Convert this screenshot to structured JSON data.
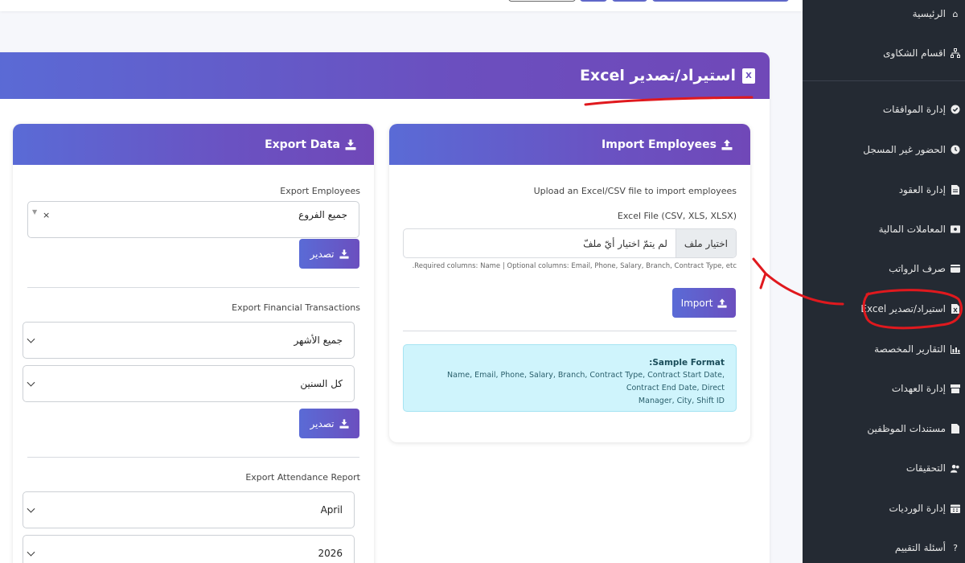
{
  "page": {
    "title": "استيراد/تصدير Excel"
  },
  "sidebar": {
    "items": [
      {
        "label": "الرئيسية",
        "icon": "home-icon"
      },
      {
        "label": "اقسام الشكاوى",
        "icon": "sitemap-icon"
      },
      {
        "label": "إدارة الموافقات",
        "icon": "check-circle-icon"
      },
      {
        "label": "الحضور غير المسجل",
        "icon": "clock-icon"
      },
      {
        "label": "إدارة العقود",
        "icon": "contract-icon"
      },
      {
        "label": "المعاملات المالية",
        "icon": "money-icon"
      },
      {
        "label": "صرف الرواتب",
        "icon": "wallet-icon"
      },
      {
        "label": "استيراد/تصدير Excel",
        "icon": "excel-file-icon"
      },
      {
        "label": "التقارير المخصصة",
        "icon": "chart-icon"
      },
      {
        "label": "إدارة العهدات",
        "icon": "box-icon"
      },
      {
        "label": "مستندات الموظفين",
        "icon": "document-icon"
      },
      {
        "label": "التحقيقات",
        "icon": "users-icon"
      },
      {
        "label": "إدارة الورديات",
        "icon": "calendar-icon"
      },
      {
        "label": "أسئلة التقييم",
        "icon": "question-icon"
      }
    ]
  },
  "import_card": {
    "title": "Import Employees",
    "description": "Upload an Excel/CSV file to import employees",
    "file_label": "Excel File (CSV, XLS, XLSX)",
    "file_button": "اختيار ملف",
    "file_status": "لم يتمّ اختيار أيّ ملفّ",
    "help_text": ".Required columns: Name | Optional columns: Email, Phone, Salary, Branch, Contract Type, etc",
    "import_button": "Import",
    "sample_title": ":Sample Format",
    "sample_line1": "Name, Email, Phone, Salary, Branch, Contract Type, Contract Start Date, Contract End Date, Direct",
    "sample_line2": "Manager, City, Shift ID"
  },
  "export_card": {
    "title": "Export Data",
    "employees_label": "Export Employees",
    "branches_value": "جميع الفروع",
    "clear_symbol": "×",
    "export_button": "تصدير",
    "financial_label": "Export Financial Transactions",
    "months_value": "جميع الأشهر",
    "years_value": "كل السنين",
    "attendance_label": "Export Attendance Report",
    "month_value": "April",
    "year_value": "2026"
  },
  "colors": {
    "accent_start": "#5a6bd6",
    "accent_end": "#7048b8",
    "sidebar_bg": "#242a33",
    "alert_bg": "#cff4fc",
    "annotation_red": "#e0191e"
  }
}
